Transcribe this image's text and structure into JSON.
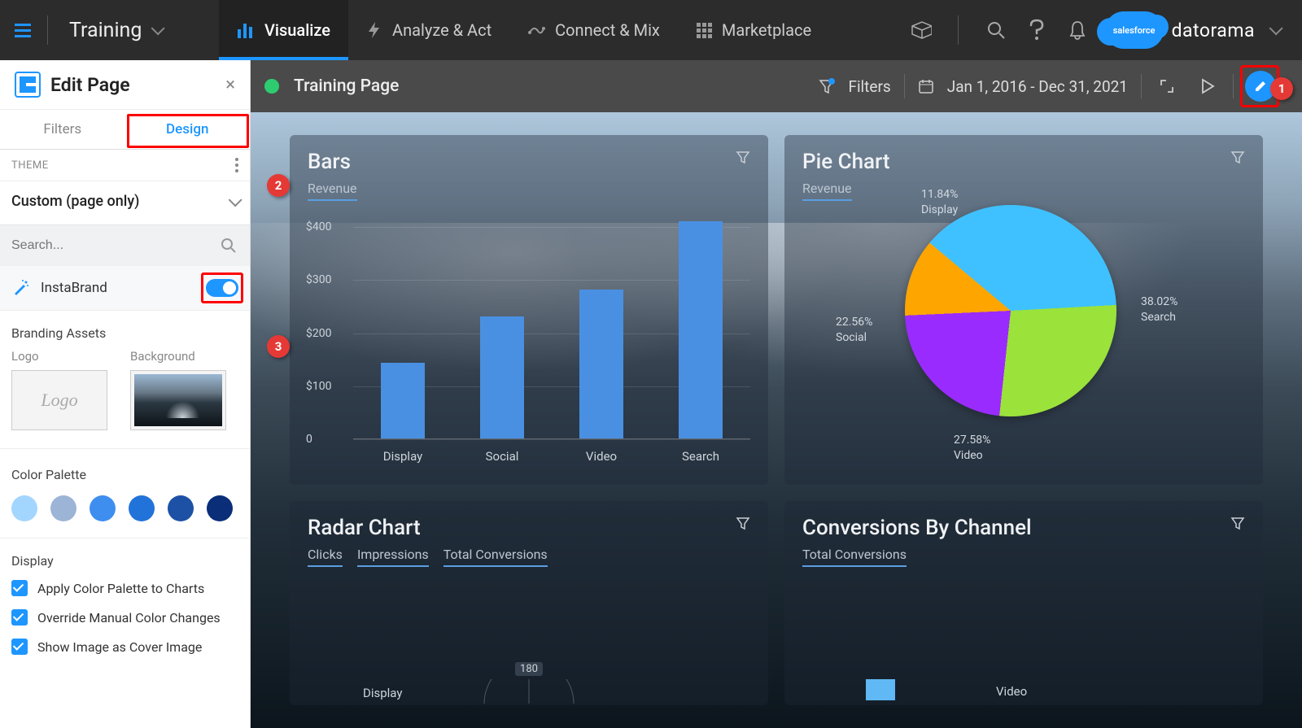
{
  "workspace_name": "Training",
  "nav": {
    "visualize": "Visualize",
    "analyze": "Analyze & Act",
    "connect": "Connect & Mix",
    "marketplace": "Marketplace"
  },
  "brand": {
    "sf": "salesforce",
    "product": "datorama"
  },
  "subbar": {
    "page_title": "Training Page",
    "filters": "Filters",
    "date_range": "Jan 1, 2016 - Dec 31, 2021"
  },
  "sidebar": {
    "title": "Edit Page",
    "tabs": {
      "filters": "Filters",
      "design": "Design"
    },
    "theme_section_label": "THEME",
    "theme_name": "Custom (page only)",
    "search_placeholder": "Search...",
    "instabrand": "InstaBrand",
    "branding_assets": "Branding Assets",
    "logo_label": "Logo",
    "logo_placeholder": "Logo",
    "bg_label": "Background",
    "color_palette": "Color Palette",
    "palette": [
      "#a3d6ff",
      "#9cb4d6",
      "#3e8ef0",
      "#2273d9",
      "#1c51a5",
      "#0a2e78"
    ],
    "display_section": "Display",
    "display_opts": [
      "Apply Color Palette to Charts",
      "Override Manual Color Changes",
      "Show Image as Cover Image"
    ]
  },
  "callouts": {
    "one": "1",
    "two": "2",
    "three": "3"
  },
  "widgets": {
    "bars": {
      "title": "Bars",
      "metric": "Revenue"
    },
    "pie": {
      "title": "Pie Chart",
      "metric": "Revenue"
    },
    "radar": {
      "title": "Radar Chart",
      "metrics": [
        "Clicks",
        "Impressions",
        "Total Conversions"
      ],
      "axis0": "Display",
      "tick": "180"
    },
    "conv": {
      "title": "Conversions By Channel",
      "metric": "Total Conversions",
      "axis0": "Video"
    }
  },
  "chart_data": [
    {
      "id": "bars",
      "type": "bar",
      "title": "Bars",
      "ylabel": "Revenue",
      "categories": [
        "Display",
        "Social",
        "Video",
        "Search"
      ],
      "values": [
        142,
        230,
        280,
        410
      ],
      "yticks": [
        0,
        100,
        200,
        300,
        400
      ],
      "ylim": [
        0,
        420
      ]
    },
    {
      "id": "pie",
      "type": "pie",
      "title": "Pie Chart",
      "metric": "Revenue",
      "slices": [
        {
          "name": "Search",
          "pct": 38.02,
          "color": "#3fc1ff"
        },
        {
          "name": "Video",
          "pct": 27.58,
          "color": "#9be23a"
        },
        {
          "name": "Social",
          "pct": 22.56,
          "color": "#9a2bff"
        },
        {
          "name": "Display",
          "pct": 11.84,
          "color": "#ffa500"
        }
      ]
    }
  ]
}
